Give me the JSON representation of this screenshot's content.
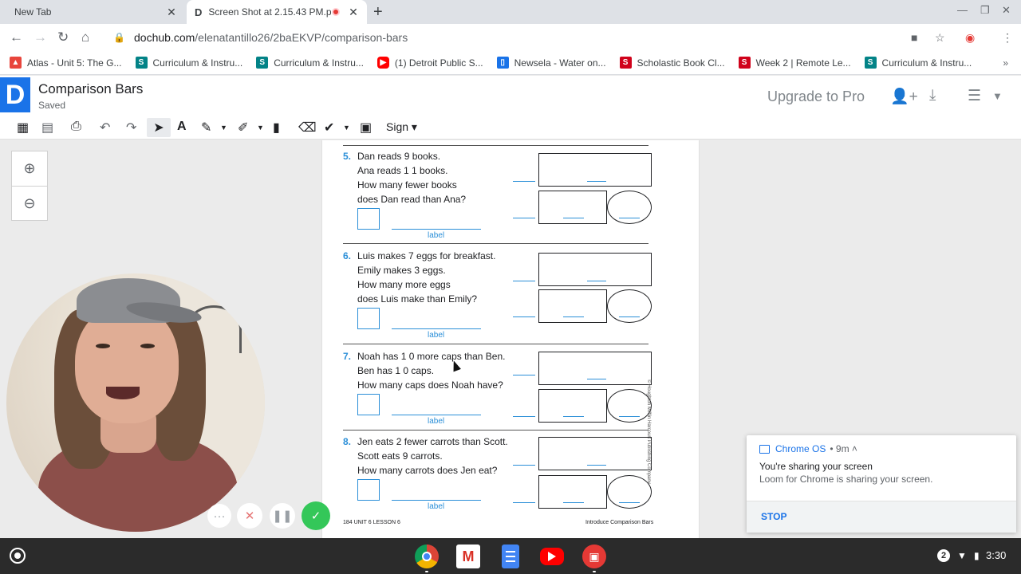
{
  "browser": {
    "tabs": [
      {
        "title": "New Tab",
        "active": false
      },
      {
        "title": "Screen Shot at 2.15.43 PM.p",
        "active": true,
        "recording": true
      }
    ],
    "url_host": "dochub.com",
    "url_path": "/elenatantillo26/2baEKVP/comparison-bars",
    "bookmarks": [
      {
        "label": "Atlas - Unit 5: The G...",
        "icon": "atlas-icon",
        "color": "#e8453c"
      },
      {
        "label": "Curriculum & Instru...",
        "icon": "sharepoint-icon",
        "color": "#038387"
      },
      {
        "label": "Curriculum & Instru...",
        "icon": "sharepoint-icon",
        "color": "#038387"
      },
      {
        "label": "(1) Detroit Public S...",
        "icon": "youtube-icon",
        "color": "#ff0000"
      },
      {
        "label": "Newsela - Water on...",
        "icon": "newsela-icon",
        "color": "#1a73e8"
      },
      {
        "label": "Scholastic Book Cl...",
        "icon": "scholastic-icon",
        "color": "#d0021b"
      },
      {
        "label": "Week 2 | Remote Le...",
        "icon": "scholastic-icon",
        "color": "#d0021b"
      },
      {
        "label": "Curriculum & Instru...",
        "icon": "sharepoint-icon",
        "color": "#038387"
      }
    ]
  },
  "dochub": {
    "logo": "D",
    "doc_title": "Comparison Bars",
    "status": "Saved",
    "upgrade_label": "Upgrade to Pro",
    "sign_label": "Sign ▾"
  },
  "worksheet": {
    "label_text": "label",
    "problems": [
      {
        "num": "5.",
        "lines": [
          "Dan reads 9 books.",
          "Ana reads 1 1 books.",
          "How many fewer books",
          "does Dan read than Ana?"
        ]
      },
      {
        "num": "6.",
        "lines": [
          "Luis makes 7 eggs for breakfast.",
          "Emily makes 3 eggs.",
          "How many more eggs",
          "does Luis make than Emily?"
        ]
      },
      {
        "num": "7.",
        "lines": [
          "Noah has 1 0 more caps than Ben.",
          "Ben has 1 0 caps.",
          "How many caps does Noah have?"
        ]
      },
      {
        "num": "8.",
        "lines": [
          "Jen eats 2 fewer carrots than Scott.",
          "Scott eats 9 carrots.",
          "How many carrots does Jen eat?"
        ]
      }
    ],
    "footer_left": "184  UNIT 6 LESSON 6",
    "footer_right": "Introduce Comparison Bars",
    "copyright": "© Houghton Mifflin Harcourt Publishing Company"
  },
  "recorder": {
    "more": "···",
    "cancel": "✕",
    "pause": "❚❚",
    "done": "✓"
  },
  "notification": {
    "source": "Chrome OS",
    "meta": "• 9m ˄",
    "title": "You're sharing your screen",
    "body": "Loom for Chrome is sharing your screen.",
    "action": "STOP"
  },
  "shelf": {
    "badge": "2",
    "time": "3:30"
  }
}
